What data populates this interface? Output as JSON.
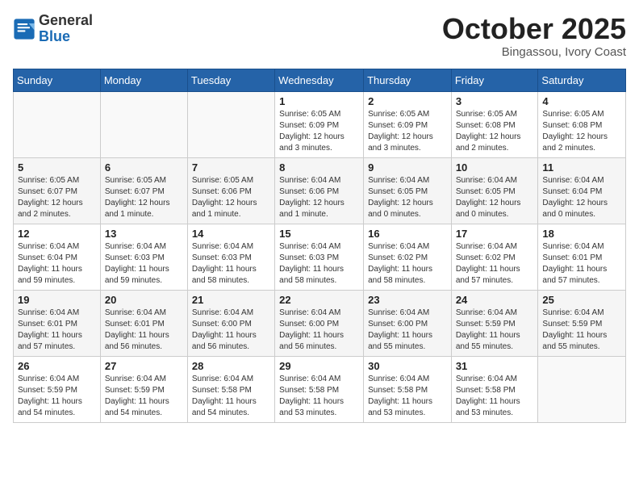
{
  "logo": {
    "general": "General",
    "blue": "Blue"
  },
  "title": "October 2025",
  "location": "Bingassou, Ivory Coast",
  "days_of_week": [
    "Sunday",
    "Monday",
    "Tuesday",
    "Wednesday",
    "Thursday",
    "Friday",
    "Saturday"
  ],
  "weeks": [
    [
      {
        "day": "",
        "info": ""
      },
      {
        "day": "",
        "info": ""
      },
      {
        "day": "",
        "info": ""
      },
      {
        "day": "1",
        "info": "Sunrise: 6:05 AM\nSunset: 6:09 PM\nDaylight: 12 hours and 3 minutes."
      },
      {
        "day": "2",
        "info": "Sunrise: 6:05 AM\nSunset: 6:09 PM\nDaylight: 12 hours and 3 minutes."
      },
      {
        "day": "3",
        "info": "Sunrise: 6:05 AM\nSunset: 6:08 PM\nDaylight: 12 hours and 2 minutes."
      },
      {
        "day": "4",
        "info": "Sunrise: 6:05 AM\nSunset: 6:08 PM\nDaylight: 12 hours and 2 minutes."
      }
    ],
    [
      {
        "day": "5",
        "info": "Sunrise: 6:05 AM\nSunset: 6:07 PM\nDaylight: 12 hours and 2 minutes."
      },
      {
        "day": "6",
        "info": "Sunrise: 6:05 AM\nSunset: 6:07 PM\nDaylight: 12 hours and 1 minute."
      },
      {
        "day": "7",
        "info": "Sunrise: 6:05 AM\nSunset: 6:06 PM\nDaylight: 12 hours and 1 minute."
      },
      {
        "day": "8",
        "info": "Sunrise: 6:04 AM\nSunset: 6:06 PM\nDaylight: 12 hours and 1 minute."
      },
      {
        "day": "9",
        "info": "Sunrise: 6:04 AM\nSunset: 6:05 PM\nDaylight: 12 hours and 0 minutes."
      },
      {
        "day": "10",
        "info": "Sunrise: 6:04 AM\nSunset: 6:05 PM\nDaylight: 12 hours and 0 minutes."
      },
      {
        "day": "11",
        "info": "Sunrise: 6:04 AM\nSunset: 6:04 PM\nDaylight: 12 hours and 0 minutes."
      }
    ],
    [
      {
        "day": "12",
        "info": "Sunrise: 6:04 AM\nSunset: 6:04 PM\nDaylight: 11 hours and 59 minutes."
      },
      {
        "day": "13",
        "info": "Sunrise: 6:04 AM\nSunset: 6:03 PM\nDaylight: 11 hours and 59 minutes."
      },
      {
        "day": "14",
        "info": "Sunrise: 6:04 AM\nSunset: 6:03 PM\nDaylight: 11 hours and 58 minutes."
      },
      {
        "day": "15",
        "info": "Sunrise: 6:04 AM\nSunset: 6:03 PM\nDaylight: 11 hours and 58 minutes."
      },
      {
        "day": "16",
        "info": "Sunrise: 6:04 AM\nSunset: 6:02 PM\nDaylight: 11 hours and 58 minutes."
      },
      {
        "day": "17",
        "info": "Sunrise: 6:04 AM\nSunset: 6:02 PM\nDaylight: 11 hours and 57 minutes."
      },
      {
        "day": "18",
        "info": "Sunrise: 6:04 AM\nSunset: 6:01 PM\nDaylight: 11 hours and 57 minutes."
      }
    ],
    [
      {
        "day": "19",
        "info": "Sunrise: 6:04 AM\nSunset: 6:01 PM\nDaylight: 11 hours and 57 minutes."
      },
      {
        "day": "20",
        "info": "Sunrise: 6:04 AM\nSunset: 6:01 PM\nDaylight: 11 hours and 56 minutes."
      },
      {
        "day": "21",
        "info": "Sunrise: 6:04 AM\nSunset: 6:00 PM\nDaylight: 11 hours and 56 minutes."
      },
      {
        "day": "22",
        "info": "Sunrise: 6:04 AM\nSunset: 6:00 PM\nDaylight: 11 hours and 56 minutes."
      },
      {
        "day": "23",
        "info": "Sunrise: 6:04 AM\nSunset: 6:00 PM\nDaylight: 11 hours and 55 minutes."
      },
      {
        "day": "24",
        "info": "Sunrise: 6:04 AM\nSunset: 5:59 PM\nDaylight: 11 hours and 55 minutes."
      },
      {
        "day": "25",
        "info": "Sunrise: 6:04 AM\nSunset: 5:59 PM\nDaylight: 11 hours and 55 minutes."
      }
    ],
    [
      {
        "day": "26",
        "info": "Sunrise: 6:04 AM\nSunset: 5:59 PM\nDaylight: 11 hours and 54 minutes."
      },
      {
        "day": "27",
        "info": "Sunrise: 6:04 AM\nSunset: 5:59 PM\nDaylight: 11 hours and 54 minutes."
      },
      {
        "day": "28",
        "info": "Sunrise: 6:04 AM\nSunset: 5:58 PM\nDaylight: 11 hours and 54 minutes."
      },
      {
        "day": "29",
        "info": "Sunrise: 6:04 AM\nSunset: 5:58 PM\nDaylight: 11 hours and 53 minutes."
      },
      {
        "day": "30",
        "info": "Sunrise: 6:04 AM\nSunset: 5:58 PM\nDaylight: 11 hours and 53 minutes."
      },
      {
        "day": "31",
        "info": "Sunrise: 6:04 AM\nSunset: 5:58 PM\nDaylight: 11 hours and 53 minutes."
      },
      {
        "day": "",
        "info": ""
      }
    ]
  ]
}
